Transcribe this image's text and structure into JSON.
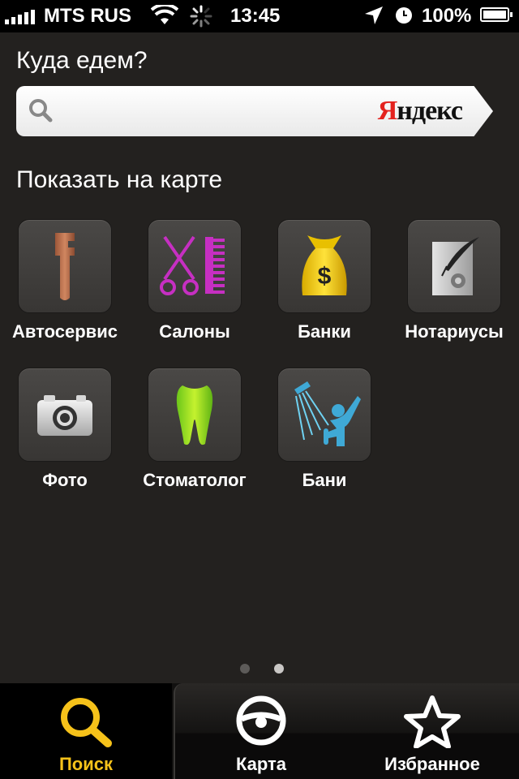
{
  "status_bar": {
    "carrier": "MTS RUS",
    "time": "13:45",
    "battery": "100%"
  },
  "heading": "Куда едем?",
  "search": {
    "placeholder": "",
    "brand_first": "Я",
    "brand_rest": "ндекс"
  },
  "section_title": "Показать на карте",
  "categories": [
    {
      "label": "Автосервис",
      "icon": "wrench-icon"
    },
    {
      "label": "Салоны",
      "icon": "scissors-comb-icon"
    },
    {
      "label": "Банки",
      "icon": "money-bag-icon"
    },
    {
      "label": "Нотариусы",
      "icon": "quill-document-icon"
    },
    {
      "label": "Фото",
      "icon": "camera-icon"
    },
    {
      "label": "Стоматолог",
      "icon": "tooth-icon"
    },
    {
      "label": "Бани",
      "icon": "shower-icon"
    }
  ],
  "pager": {
    "pages": 2,
    "current": 2
  },
  "tabs": [
    {
      "label": "Поиск",
      "icon": "search-icon",
      "active": true
    },
    {
      "label": "Карта",
      "icon": "steering-wheel-icon",
      "active": false
    },
    {
      "label": "Избранное",
      "icon": "star-icon",
      "active": false
    }
  ],
  "colors": {
    "accent": "#f6c21a",
    "brand_red": "#e4221e",
    "background": "#23211f"
  }
}
